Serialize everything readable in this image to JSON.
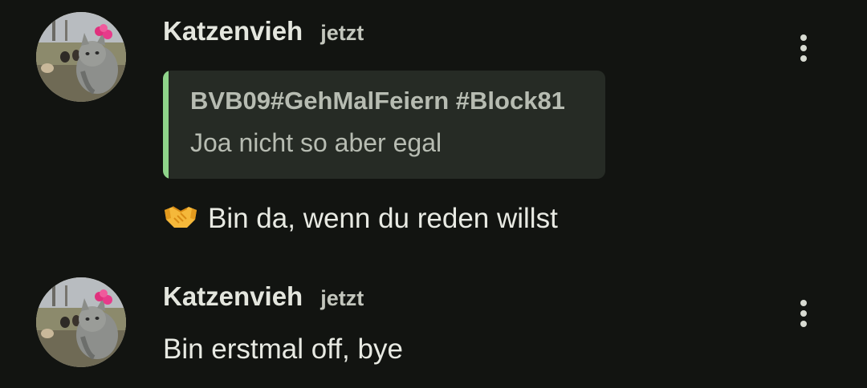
{
  "messages": [
    {
      "author": "Katzenvieh",
      "time": "jetzt",
      "avatar_icon": "cat-photo-avatar",
      "reply": {
        "title": "BVB09#GehMalFeiern #Block81",
        "text": "Joa nicht so aber egal"
      },
      "emoji": "🤝",
      "text": "Bin da, wenn du reden willst"
    },
    {
      "author": "Katzenvieh",
      "time": "jetzt",
      "avatar_icon": "cat-photo-avatar",
      "text": "Bin erstmal off, bye"
    }
  ],
  "colors": {
    "background": "#121411",
    "quote_background": "#262b25",
    "quote_accent": "#8fd48a",
    "text_primary": "#e8eae3",
    "text_secondary": "#c3c6bd"
  }
}
